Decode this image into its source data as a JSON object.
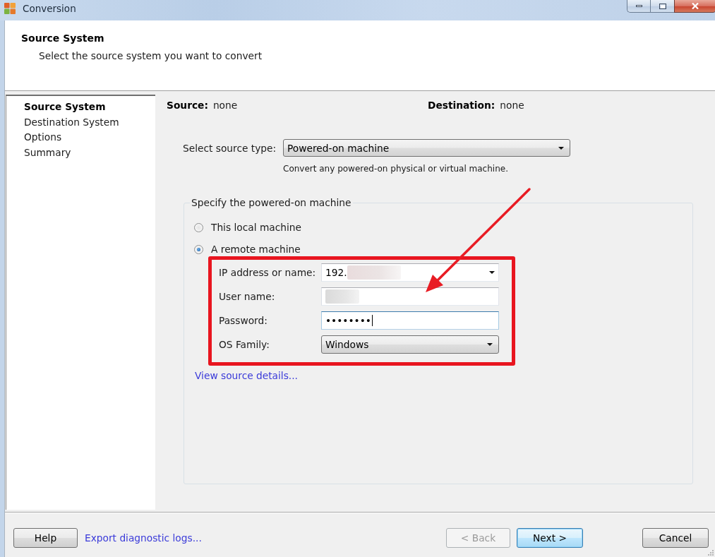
{
  "window": {
    "title": "Conversion"
  },
  "header": {
    "title": "Source System",
    "subtitle": "Select the source system you want to convert"
  },
  "steps": [
    {
      "label": "Source System",
      "selected": true
    },
    {
      "label": "Destination System",
      "selected": false
    },
    {
      "label": "Options",
      "selected": false
    },
    {
      "label": "Summary",
      "selected": false
    }
  ],
  "summary": [
    {
      "label": "Source:",
      "value": "none"
    },
    {
      "label": "Destination:",
      "value": "none"
    }
  ],
  "source_type": {
    "label": "Select source type:",
    "value": "Powered-on machine",
    "hint": "Convert any powered-on physical or virtual machine."
  },
  "machine_group": {
    "title": "Specify the powered-on machine",
    "options": [
      {
        "label": "This local machine",
        "selected": false
      },
      {
        "label": "A remote machine",
        "selected": true
      }
    ],
    "fields": [
      {
        "kind": "combo",
        "label": "IP address or name:",
        "value": "192.",
        "redacted": true,
        "focused": false
      },
      {
        "kind": "text",
        "label": "User name:",
        "redacted": true,
        "focused": false
      },
      {
        "kind": "password",
        "label": "Password:",
        "value": "••••••••",
        "redacted": false,
        "focused": true
      },
      {
        "kind": "dropdown",
        "label": "OS Family:",
        "value": "Windows",
        "redacted": false,
        "focused": false
      }
    ],
    "details_link": {
      "label": "View source details..."
    }
  },
  "footer": {
    "help": {
      "label": "Help"
    },
    "export_link": {
      "label": "Export diagnostic logs..."
    },
    "navigation": [
      {
        "label": "< Back",
        "disabled": true,
        "default": false
      },
      {
        "label": "Next >",
        "disabled": false,
        "default": true
      }
    ],
    "cancel": {
      "label": "Cancel"
    }
  }
}
